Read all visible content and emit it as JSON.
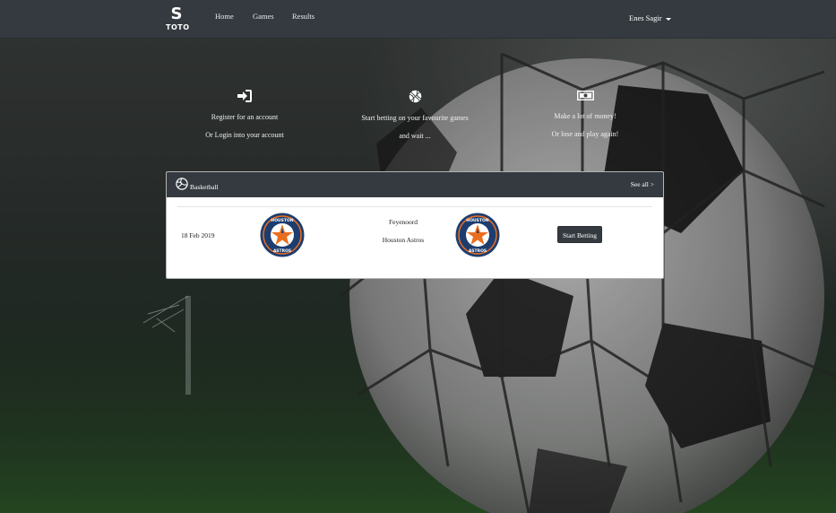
{
  "brand": {
    "logo_letter": "S",
    "logo_text": "TOTO"
  },
  "nav": {
    "items": [
      {
        "label": "Home"
      },
      {
        "label": "Games"
      },
      {
        "label": "Results"
      }
    ],
    "user": "Enes Sagir"
  },
  "steps": [
    {
      "icon": "sign-in-icon",
      "line1": "Register for an account",
      "line2": "Or Login into your account"
    },
    {
      "icon": "basketball-icon",
      "line1": "Start betting on your favourite games",
      "line2": "and wait ..."
    },
    {
      "icon": "money-bill-icon",
      "line1": "Make a lot of money!",
      "line2": "Or lose and play again!"
    }
  ],
  "card": {
    "icon": "volleyball-icon",
    "title": "Basketball",
    "see_all": "See all >",
    "match": {
      "date": "18 Feb 2019",
      "home_team": "Feyenoord",
      "away_team": "Houston Astros",
      "home_logo": "houston-astros-logo",
      "away_logo": "houston-astros-logo",
      "bet_label": "Start Betting"
    }
  },
  "colors": {
    "navbar": "#343a40",
    "astros_navy": "#1d3d6e",
    "astros_orange": "#eb6e1f"
  }
}
